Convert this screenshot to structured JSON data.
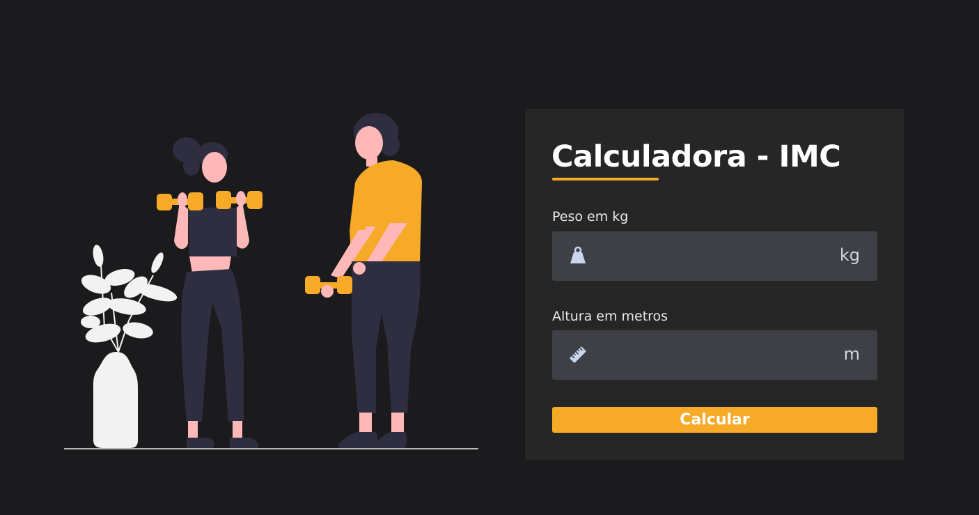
{
  "title": "Calculadora - IMC",
  "form": {
    "peso": {
      "label": "Peso em kg",
      "value": "",
      "unit": "kg",
      "icon": "weight-icon"
    },
    "altura": {
      "label": "Altura em metros",
      "value": "",
      "unit": "m",
      "icon": "ruler-icon"
    },
    "submit_label": "Calcular"
  },
  "colors": {
    "background": "#1b1b1d",
    "card": "#262626",
    "input": "#3f4046",
    "accent": "#f7a928",
    "text": "#ffffff"
  }
}
